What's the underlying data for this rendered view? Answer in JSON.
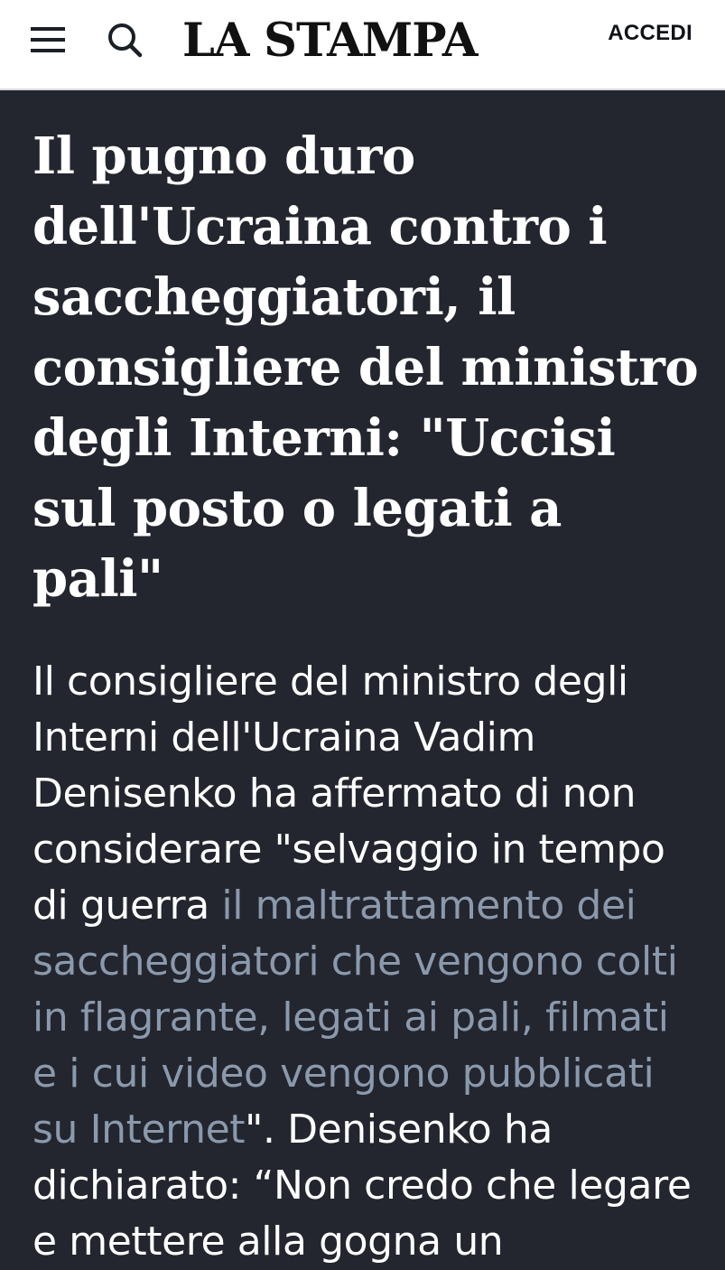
{
  "header": {
    "logo": "LA STAMPA",
    "login_label": "ACCEDI",
    "menu_icon": "hamburger-menu-icon",
    "search_icon": "search-icon"
  },
  "article": {
    "headline": "Il pugno duro dell'Ucraina contro i saccheggiatori, il consigliere del ministro degli Interni: \"Uccisi sul posto o legati a pali\"",
    "summary_start": "Il consigliere del ministro degli Interni dell'Ucraina Vadim Denisenko ha affermato di non considerare \"selvaggio in tempo di guerra ",
    "summary_link": "il maltrattamento dei saccheggiatori che vengono colti in flagrante, legati ai pali, filmati e i cui video vengono pubblicati su Internet",
    "summary_end": "\".  Denisenko ha dichiarato: “Non credo che legare e mettere alla gogna un"
  },
  "colors": {
    "header_bg": "#ffffff",
    "page_bg": "#23262e",
    "text": "#ffffff",
    "link_text": "#8b99ad"
  }
}
